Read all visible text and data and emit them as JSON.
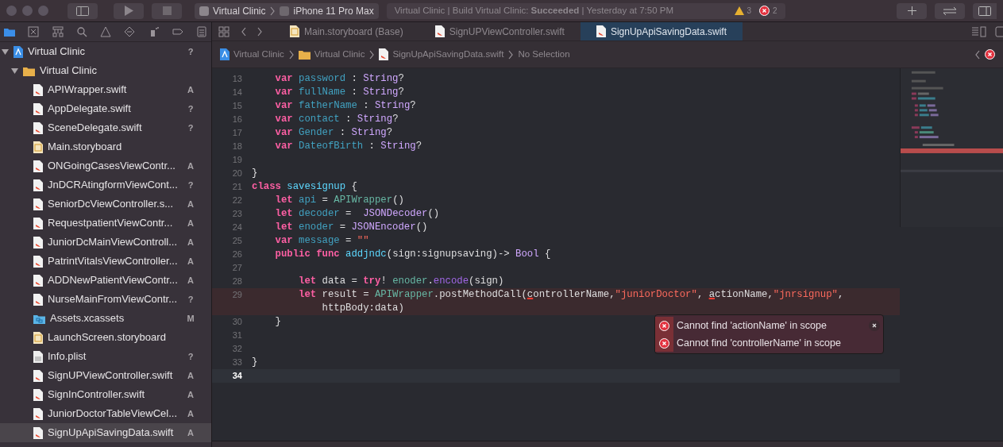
{
  "toolbar": {
    "scheme": {
      "project": "Virtual Clinic",
      "device": "iPhone 11 Pro Max"
    },
    "status": {
      "text": "Virtual Clinic | Build Virtual Clinic: **Succeeded** | Yesterday at 7:50 PM",
      "warnings": "3",
      "errors": "2"
    }
  },
  "navigator": {
    "tabs": [
      {
        "kind": "folder",
        "selected": true
      },
      {
        "kind": "source-control",
        "selected": false
      },
      {
        "kind": "hierarchy",
        "selected": false
      },
      {
        "kind": "search",
        "selected": false
      },
      {
        "kind": "warning",
        "selected": false
      },
      {
        "kind": "test",
        "selected": false
      },
      {
        "kind": "debug",
        "selected": false
      },
      {
        "kind": "breakpoint",
        "selected": false
      },
      {
        "kind": "report",
        "selected": false
      }
    ],
    "tree": [
      {
        "name": "Virtual Clinic",
        "kind": "project",
        "badge": "?",
        "expanded": true,
        "selected": false,
        "children": [
          {
            "name": "Virtual Clinic",
            "kind": "folder",
            "expanded": true,
            "selected": false,
            "children": [
              {
                "name": "APIWrapper.swift",
                "kind": "swift",
                "badge": "A",
                "selected": false
              },
              {
                "name": "AppDelegate.swift",
                "kind": "swift",
                "badge": "?",
                "selected": false
              },
              {
                "name": "SceneDelegate.swift",
                "kind": "swift",
                "badge": "?",
                "selected": false
              },
              {
                "name": "Main.storyboard",
                "kind": "storyboard",
                "selected": false
              },
              {
                "name": "ONGoingCasesViewContr...",
                "kind": "swift",
                "badge": "A",
                "selected": false
              },
              {
                "name": "JnDCRAtingformViewCont...",
                "kind": "swift",
                "badge": "?",
                "selected": false
              },
              {
                "name": "SeniorDcViewController.s...",
                "kind": "swift",
                "badge": "A",
                "selected": false
              },
              {
                "name": "RequestpatientViewContr...",
                "kind": "swift",
                "badge": "A",
                "selected": false
              },
              {
                "name": "JuniorDcMainViewControll...",
                "kind": "swift",
                "badge": "A",
                "selected": false
              },
              {
                "name": "PatrintVitalsViewController...",
                "kind": "swift",
                "badge": "A",
                "selected": false
              },
              {
                "name": "ADDNewPatientViewContr...",
                "kind": "swift",
                "badge": "A",
                "selected": false
              },
              {
                "name": "NurseMainFromViewContr...",
                "kind": "swift",
                "badge": "?",
                "selected": false
              },
              {
                "name": "Assets.xcassets",
                "kind": "assets",
                "badge": "M",
                "selected": false
              },
              {
                "name": "LaunchScreen.storyboard",
                "kind": "storyboard",
                "selected": false
              },
              {
                "name": "Info.plist",
                "kind": "plist",
                "badge": "?",
                "selected": false
              },
              {
                "name": "SignUPViewController.swift",
                "kind": "swift",
                "badge": "A",
                "selected": false
              },
              {
                "name": "SignInController.swift",
                "kind": "swift",
                "badge": "A",
                "selected": false
              },
              {
                "name": "JuniorDoctorTableViewCel...",
                "kind": "swift",
                "badge": "A",
                "selected": false
              },
              {
                "name": "SignUpApiSavingData.swift",
                "kind": "swift",
                "badge": "A",
                "selected": true
              }
            ]
          }
        ]
      }
    ]
  },
  "editor": {
    "tabs": [
      {
        "label": "Main.storyboard (Base)",
        "kind": "storyboard",
        "selected": false
      },
      {
        "label": "SignUPViewController.swift",
        "kind": "swift",
        "selected": false
      },
      {
        "label": "SignUpApiSavingData.swift",
        "kind": "swift",
        "selected": true
      }
    ],
    "jump_bar": [
      {
        "label": "Virtual Clinic",
        "kind": "project"
      },
      {
        "label": "Virtual Clinic",
        "kind": "folder"
      },
      {
        "label": "SignUpApiSavingData.swift",
        "kind": "swift"
      },
      {
        "label": "No Selection",
        "kind": "none"
      }
    ],
    "lines": [
      {
        "number": "13",
        "error": false,
        "current": false,
        "tokens": [
          {
            "kind": "keyword",
            "text": "    var"
          },
          {
            "kind": "property",
            "text": " password"
          },
          {
            "kind": "plain",
            "text": " : "
          },
          {
            "kind": "type",
            "text": "String"
          },
          {
            "kind": "plain",
            "text": "?"
          }
        ]
      },
      {
        "number": "14",
        "error": false,
        "current": false,
        "tokens": [
          {
            "kind": "keyword",
            "text": "    var"
          },
          {
            "kind": "property",
            "text": " fullName"
          },
          {
            "kind": "plain",
            "text": " : "
          },
          {
            "kind": "type",
            "text": "String"
          },
          {
            "kind": "plain",
            "text": "?"
          }
        ]
      },
      {
        "number": "15",
        "error": false,
        "current": false,
        "tokens": [
          {
            "kind": "keyword",
            "text": "    var"
          },
          {
            "kind": "property",
            "text": " fatherName"
          },
          {
            "kind": "plain",
            "text": " : "
          },
          {
            "kind": "type",
            "text": "String"
          },
          {
            "kind": "plain",
            "text": "?"
          }
        ]
      },
      {
        "number": "16",
        "error": false,
        "current": false,
        "tokens": [
          {
            "kind": "keyword",
            "text": "    var"
          },
          {
            "kind": "property",
            "text": " contact"
          },
          {
            "kind": "plain",
            "text": " : "
          },
          {
            "kind": "type",
            "text": "String"
          },
          {
            "kind": "plain",
            "text": "?"
          }
        ]
      },
      {
        "number": "17",
        "error": false,
        "current": false,
        "tokens": [
          {
            "kind": "keyword",
            "text": "    var"
          },
          {
            "kind": "property",
            "text": " Gender"
          },
          {
            "kind": "plain",
            "text": " : "
          },
          {
            "kind": "type",
            "text": "String"
          },
          {
            "kind": "plain",
            "text": "?"
          }
        ]
      },
      {
        "number": "18",
        "error": false,
        "current": false,
        "tokens": [
          {
            "kind": "keyword",
            "text": "    var"
          },
          {
            "kind": "property",
            "text": " DateofBirth"
          },
          {
            "kind": "plain",
            "text": " : "
          },
          {
            "kind": "type",
            "text": "String"
          },
          {
            "kind": "plain",
            "text": "?"
          }
        ]
      },
      {
        "number": "19",
        "error": false,
        "current": false
      },
      {
        "number": "20",
        "error": false,
        "current": false,
        "tokens": [
          {
            "kind": "plain",
            "text": "}"
          }
        ]
      },
      {
        "number": "21",
        "error": false,
        "current": false,
        "tokens": [
          {
            "kind": "keyword",
            "text": "class"
          },
          {
            "kind": "declaration",
            "text": " savesignup"
          },
          {
            "kind": "plain",
            "text": " {"
          }
        ]
      },
      {
        "number": "22",
        "error": false,
        "current": false,
        "tokens": [
          {
            "kind": "keyword",
            "text": "    let"
          },
          {
            "kind": "property",
            "text": " api"
          },
          {
            "kind": "plain",
            "text": " = "
          },
          {
            "kind": "project-type",
            "text": "APIWrapper"
          },
          {
            "kind": "plain",
            "text": "()"
          }
        ]
      },
      {
        "number": "23",
        "error": false,
        "current": false,
        "tokens": [
          {
            "kind": "keyword",
            "text": "    let"
          },
          {
            "kind": "property",
            "text": " decoder"
          },
          {
            "kind": "plain",
            "text": " =  "
          },
          {
            "kind": "type",
            "text": "JSONDecoder"
          },
          {
            "kind": "plain",
            "text": "()"
          }
        ]
      },
      {
        "number": "24",
        "error": false,
        "current": false,
        "tokens": [
          {
            "kind": "keyword",
            "text": "    let"
          },
          {
            "kind": "property",
            "text": " enoder"
          },
          {
            "kind": "plain",
            "text": " = "
          },
          {
            "kind": "type",
            "text": "JSONEncoder"
          },
          {
            "kind": "plain",
            "text": "()"
          }
        ]
      },
      {
        "number": "25",
        "error": false,
        "current": false,
        "tokens": [
          {
            "kind": "keyword",
            "text": "    var"
          },
          {
            "kind": "property",
            "text": " message"
          },
          {
            "kind": "plain",
            "text": " = "
          },
          {
            "kind": "string",
            "text": "\"\""
          }
        ]
      },
      {
        "number": "26",
        "error": false,
        "current": false,
        "tokens": [
          {
            "kind": "keyword",
            "text": "    public func"
          },
          {
            "kind": "declaration",
            "text": " addjndc"
          },
          {
            "kind": "plain",
            "text": "(sign:signupsaving)-> "
          },
          {
            "kind": "type",
            "text": "Bool"
          },
          {
            "kind": "plain",
            "text": " {"
          }
        ]
      },
      {
        "number": "27",
        "error": false,
        "current": false
      },
      {
        "number": "28",
        "error": false,
        "current": false,
        "tokens": [
          {
            "kind": "keyword",
            "text": "        let"
          },
          {
            "kind": "plain",
            "text": " data = "
          },
          {
            "kind": "keyword",
            "text": "try"
          },
          {
            "kind": "plain",
            "text": "! "
          },
          {
            "kind": "project-type",
            "text": "enoder"
          },
          {
            "kind": "plain",
            "text": "."
          },
          {
            "kind": "method",
            "text": "encode"
          },
          {
            "kind": "plain",
            "text": "(sign)"
          }
        ]
      },
      {
        "number": "29",
        "error": true,
        "current": false,
        "tokens": [
          {
            "kind": "keyword",
            "text": "        let"
          },
          {
            "kind": "plain",
            "text": " result = "
          },
          {
            "kind": "project-type",
            "text": "APIWrapper"
          },
          {
            "kind": "plain",
            "text": ".postMethodCall("
          },
          {
            "kind": "unresolved",
            "text": "c"
          },
          {
            "kind": "plain",
            "text": "ontrollerName,"
          },
          {
            "kind": "string",
            "text": "\"juniorDoctor\""
          },
          {
            "kind": "plain",
            "text": ", "
          },
          {
            "kind": "unresolved",
            "text": "a"
          },
          {
            "kind": "plain",
            "text": "ctionName,"
          },
          {
            "kind": "string",
            "text": "\"jnrsignup\""
          },
          {
            "kind": "plain",
            "text": ","
          }
        ],
        "continuation": [
          {
            "kind": "plain",
            "text": "            httpBody:data)"
          }
        ]
      },
      {
        "number": "30",
        "error": false,
        "current": false,
        "tokens": [
          {
            "kind": "plain",
            "text": "    }"
          }
        ]
      },
      {
        "number": "31",
        "error": false,
        "current": false
      },
      {
        "number": "32",
        "error": false,
        "current": false
      },
      {
        "number": "33",
        "error": false,
        "current": false,
        "tokens": [
          {
            "kind": "plain",
            "text": "}"
          }
        ]
      },
      {
        "number": "34",
        "error": false,
        "current": true
      }
    ],
    "issues": [
      {
        "message": "Cannot find 'actionName' in scope",
        "kind": "error"
      },
      {
        "message": "Cannot find 'controllerName' in scope",
        "kind": "error"
      }
    ]
  }
}
